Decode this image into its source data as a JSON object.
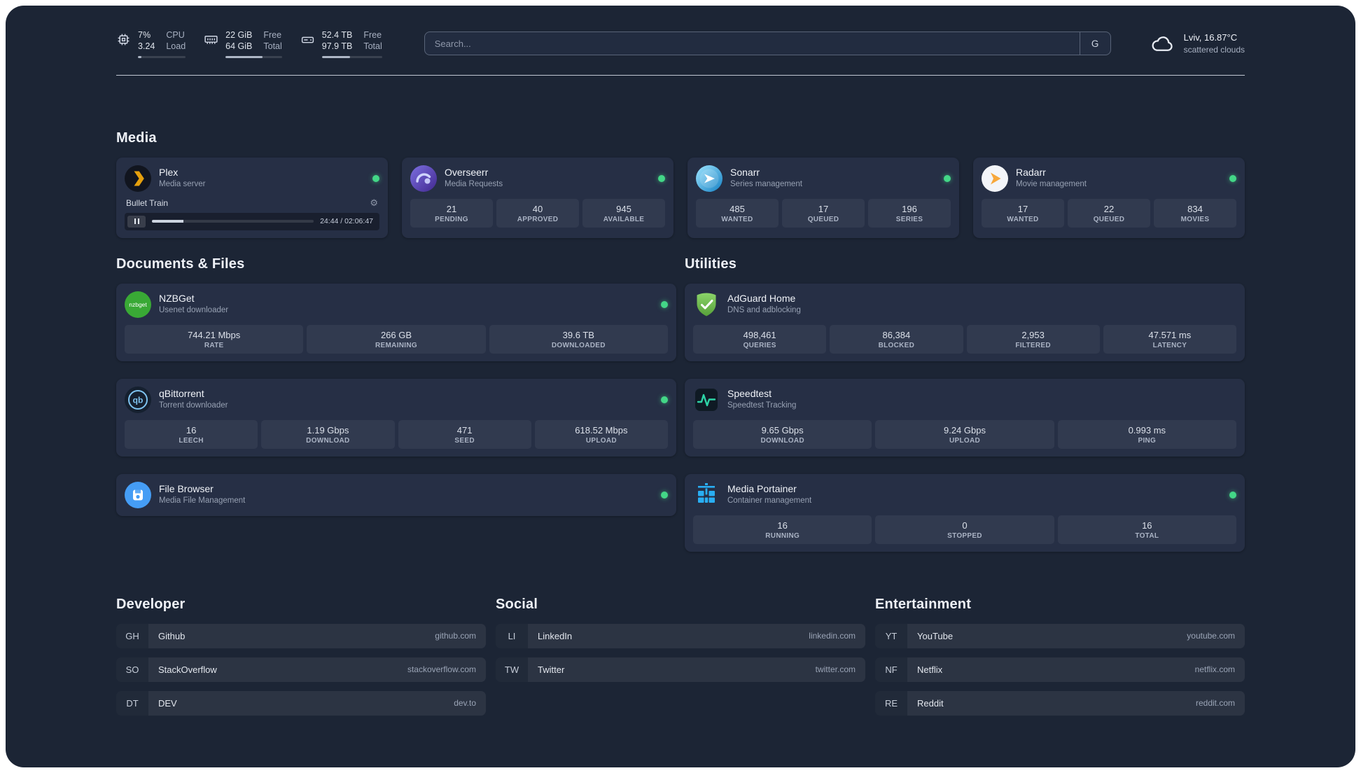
{
  "topbar": {
    "resources": [
      {
        "icon": "cpu-icon",
        "values": [
          "7%",
          "3.24"
        ],
        "labels": [
          "CPU",
          "Load"
        ],
        "bar_percent": 7
      },
      {
        "icon": "memory-icon",
        "values": [
          "22 GiB",
          "64 GiB"
        ],
        "labels": [
          "Free",
          "Total"
        ],
        "bar_percent": 66
      },
      {
        "icon": "disk-icon",
        "values": [
          "52.4 TB",
          "97.9 TB"
        ],
        "labels": [
          "Free",
          "Total"
        ],
        "bar_percent": 47
      }
    ],
    "search": {
      "placeholder": "Search...",
      "provider_button": "G"
    },
    "weather": {
      "icon": "cloud-icon",
      "location": "Lviv, 16.87°C",
      "condition": "scattered clouds"
    }
  },
  "sections": {
    "media": {
      "title": "Media",
      "cards": [
        {
          "icon": "plex-icon",
          "name": "Plex",
          "description": "Media server",
          "online": true,
          "player": {
            "title": "Bullet Train",
            "time": "24:44 / 02:06:47",
            "progress_percent": 19.5
          }
        },
        {
          "icon": "overseerr-icon",
          "name": "Overseerr",
          "description": "Media Requests",
          "online": true,
          "stats": [
            {
              "value": "21",
              "label": "PENDING"
            },
            {
              "value": "40",
              "label": "APPROVED"
            },
            {
              "value": "945",
              "label": "AVAILABLE"
            }
          ]
        },
        {
          "icon": "sonarr-icon",
          "name": "Sonarr",
          "description": "Series management",
          "online": true,
          "stats": [
            {
              "value": "485",
              "label": "WANTED"
            },
            {
              "value": "17",
              "label": "QUEUED"
            },
            {
              "value": "196",
              "label": "SERIES"
            }
          ]
        },
        {
          "icon": "radarr-icon",
          "name": "Radarr",
          "description": "Movie management",
          "online": true,
          "stats": [
            {
              "value": "17",
              "label": "WANTED"
            },
            {
              "value": "22",
              "label": "QUEUED"
            },
            {
              "value": "834",
              "label": "MOVIES"
            }
          ]
        }
      ]
    },
    "documents": {
      "title": "Documents & Files",
      "cards": [
        {
          "icon": "nzbget-icon",
          "name": "NZBGet",
          "description": "Usenet downloader",
          "online": true,
          "stats": [
            {
              "value": "744.21 Mbps",
              "label": "RATE"
            },
            {
              "value": "266 GB",
              "label": "REMAINING"
            },
            {
              "value": "39.6 TB",
              "label": "DOWNLOADED"
            }
          ]
        },
        {
          "icon": "qbittorrent-icon",
          "name": "qBittorrent",
          "description": "Torrent downloader",
          "online": true,
          "stats": [
            {
              "value": "16",
              "label": "LEECH"
            },
            {
              "value": "1.19 Gbps",
              "label": "DOWNLOAD"
            },
            {
              "value": "471",
              "label": "SEED"
            },
            {
              "value": "618.52 Mbps",
              "label": "UPLOAD"
            }
          ]
        },
        {
          "icon": "filebrowser-icon",
          "name": "File Browser",
          "description": "Media File Management",
          "online": true,
          "stats": []
        }
      ]
    },
    "utilities": {
      "title": "Utilities",
      "cards": [
        {
          "icon": "adguard-icon",
          "name": "AdGuard Home",
          "description": "DNS and adblocking",
          "online": false,
          "stats": [
            {
              "value": "498,461",
              "label": "QUERIES"
            },
            {
              "value": "86,384",
              "label": "BLOCKED"
            },
            {
              "value": "2,953",
              "label": "FILTERED"
            },
            {
              "value": "47.571 ms",
              "label": "LATENCY"
            }
          ]
        },
        {
          "icon": "speedtest-icon",
          "name": "Speedtest",
          "description": "Speedtest Tracking",
          "online": false,
          "stats": [
            {
              "value": "9.65 Gbps",
              "label": "DOWNLOAD"
            },
            {
              "value": "9.24 Gbps",
              "label": "UPLOAD"
            },
            {
              "value": "0.993 ms",
              "label": "PING"
            }
          ]
        },
        {
          "icon": "portainer-icon",
          "name": "Media Portainer",
          "description": "Container management",
          "online": true,
          "stats": [
            {
              "value": "16",
              "label": "RUNNING"
            },
            {
              "value": "0",
              "label": "STOPPED"
            },
            {
              "value": "16",
              "label": "TOTAL"
            }
          ]
        }
      ]
    }
  },
  "bookmarks": [
    {
      "title": "Developer",
      "items": [
        {
          "abbr": "GH",
          "name": "Github",
          "domain": "github.com"
        },
        {
          "abbr": "SO",
          "name": "StackOverflow",
          "domain": "stackoverflow.com"
        },
        {
          "abbr": "DT",
          "name": "DEV",
          "domain": "dev.to"
        }
      ]
    },
    {
      "title": "Social",
      "items": [
        {
          "abbr": "LI",
          "name": "LinkedIn",
          "domain": "linkedin.com"
        },
        {
          "abbr": "TW",
          "name": "Twitter",
          "domain": "twitter.com"
        }
      ]
    },
    {
      "title": "Entertainment",
      "items": [
        {
          "abbr": "YT",
          "name": "YouTube",
          "domain": "youtube.com"
        },
        {
          "abbr": "NF",
          "name": "Netflix",
          "domain": "netflix.com"
        },
        {
          "abbr": "RE",
          "name": "Reddit",
          "domain": "reddit.com"
        }
      ]
    }
  ]
}
